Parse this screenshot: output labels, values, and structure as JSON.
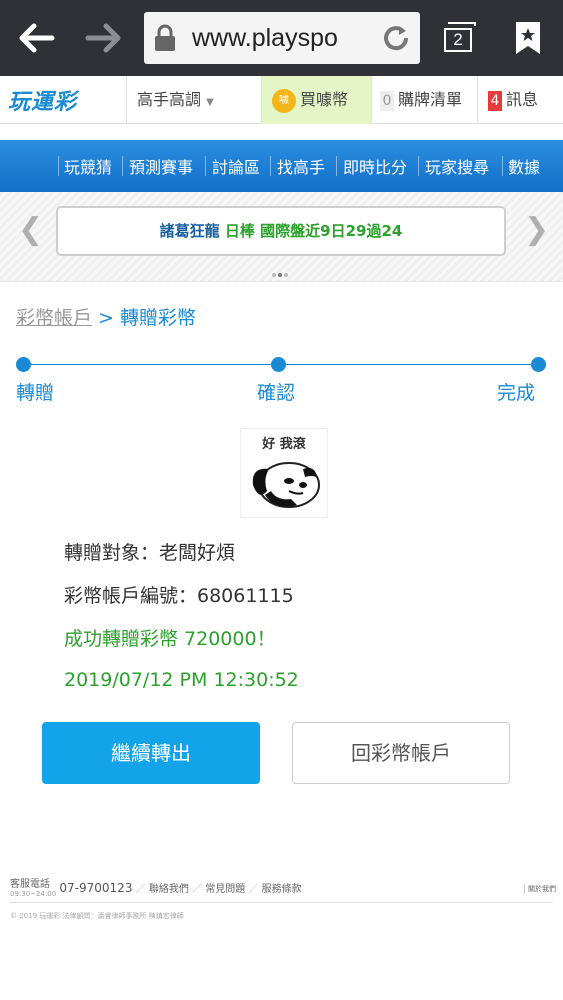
{
  "browser": {
    "back_icon": "arrow-left-icon",
    "forward_icon": "arrow-right-icon",
    "url": "www.playspo",
    "lock_icon": "lock-icon",
    "reload_icon": "reload-icon",
    "tab_count": "2",
    "bookmark_icon": "bookmark-star-icon"
  },
  "site": {
    "logo": "玩運彩",
    "experts": "高手高調",
    "buy_coin": "買噱幣",
    "coin_badge": "噱",
    "cart_count": "0",
    "cart": "購牌清單",
    "msg_count": "4",
    "msg": "訊息"
  },
  "menu": [
    "玩競猜",
    "預測賽事",
    "討論區",
    "找高手",
    "即時比分",
    "玩家搜尋",
    "數據"
  ],
  "ticker": {
    "name": "諸葛狂龍",
    "tag": "日棒",
    "record": "國際盤近9日29過24"
  },
  "breadcrumb": {
    "parent": "彩幣帳戶",
    "sep": ">",
    "current": "轉贈彩幣"
  },
  "steps": [
    "轉贈",
    "確認",
    "完成"
  ],
  "meme_caption": "好 我滾",
  "result": {
    "target": "轉贈對象：老闆好煩",
    "account": "彩幣帳戶編號：68061115",
    "success": "成功轉贈彩幣 720000！",
    "time": "2019/07/12 PM 12:30:52"
  },
  "buttons": {
    "continue": "繼續轉出",
    "back": "回彩幣帳戶"
  },
  "footer": {
    "service_label": "客服電話",
    "hours": "09:30~24:00",
    "phone": "07-9700123",
    "contact": "聯絡我們",
    "faq": "常見問題",
    "terms": "服務條款",
    "about": "關於我們",
    "copyright": "© 2019 玩運彩 法律顧問：瀛睿律師事務所 陳鎮宏律師"
  },
  "colors": {
    "accent": "#1a8ad4",
    "success": "#2ba22b",
    "primary_button": "#12a3e8"
  }
}
